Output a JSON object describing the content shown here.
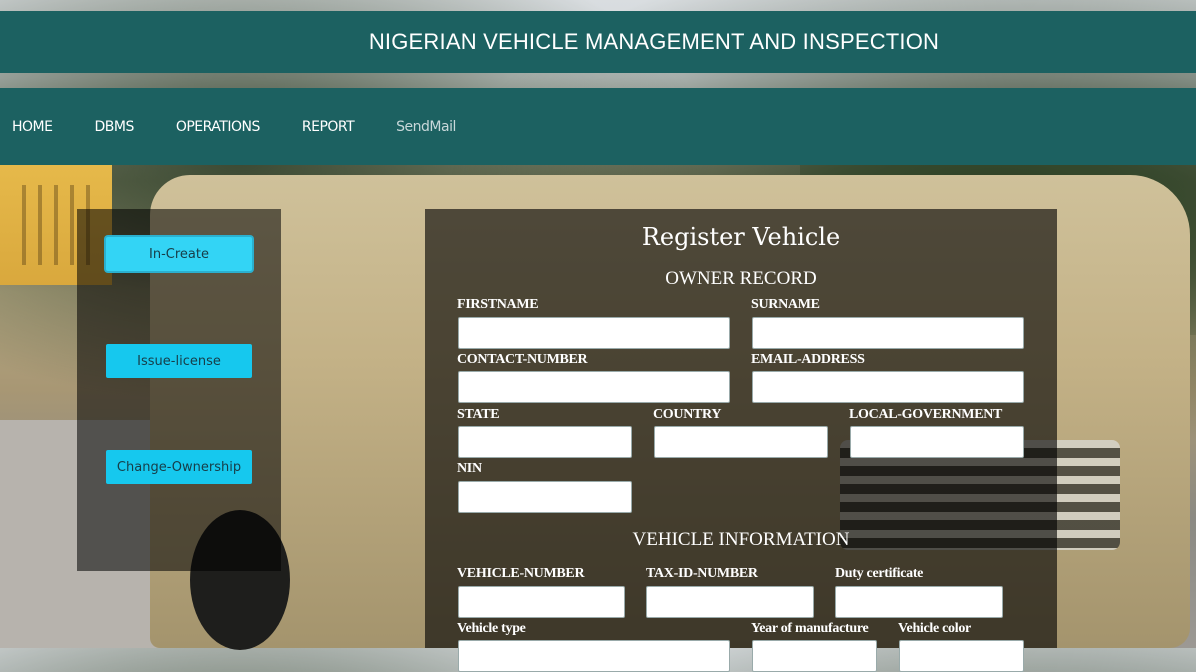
{
  "header": {
    "title": "NIGERIAN VEHICLE MANAGEMENT AND INSPECTION"
  },
  "nav": {
    "home": "HOME",
    "dbms": "DBMS",
    "operations": "OPERATIONS",
    "report": "REPORT",
    "sendmail": "SendMail"
  },
  "sidebar": {
    "in_create": "In-Create",
    "issue_license": "Issue-license",
    "change_ownership": "Change-Ownership"
  },
  "form": {
    "title": "Register Vehicle",
    "owner_section": "OWNER RECORD",
    "vehicle_section": "VEHICLE INFORMATION",
    "labels": {
      "firstname": "FIRSTNAME",
      "surname": "SURNAME",
      "contact_number": "CONTACT-NUMBER",
      "email_address": "EMAIL-ADDRESS",
      "state": "STATE",
      "country": "COUNTRY",
      "local_government": "LOCAL-GOVERNMENT",
      "nin": "NIN",
      "vehicle_number": "VEHICLE-NUMBER",
      "tax_id_number": "TAX-ID-NUMBER",
      "duty_certificate": "Duty certificate",
      "vehicle_type": "Vehicle type",
      "year_of_manufacture": "Year of manufacture",
      "vehicle_color": "Vehicle color"
    },
    "values": {
      "firstname": "",
      "surname": "",
      "contact_number": "",
      "email_address": "",
      "state": "",
      "country": "",
      "local_government": "",
      "nin": "",
      "vehicle_number": "",
      "tax_id_number": "",
      "duty_certificate": "",
      "vehicle_type": "",
      "year_of_manufacture": "",
      "vehicle_color": ""
    }
  },
  "colors": {
    "bar": "#1c6161",
    "button": "#16c8ee"
  }
}
